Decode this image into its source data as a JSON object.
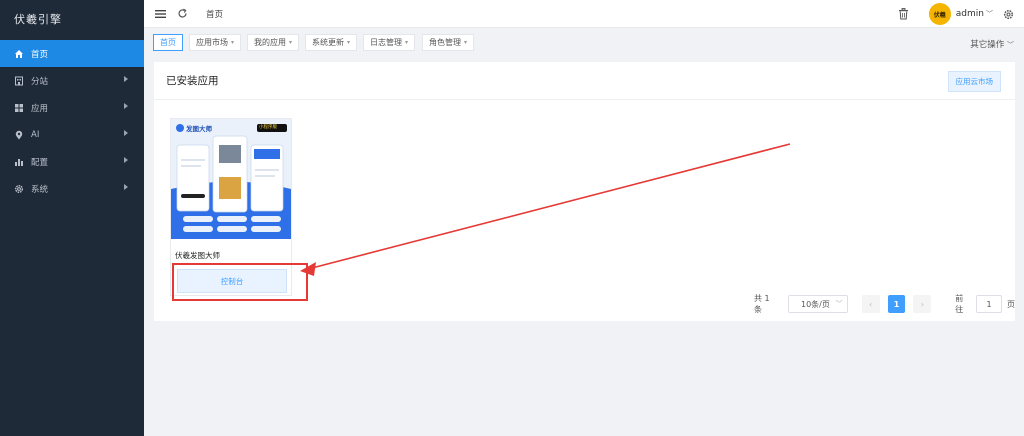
{
  "brand": "伏羲引擎",
  "sidebar": {
    "items": [
      {
        "label": "首页",
        "icon": "home-icon",
        "active": true
      },
      {
        "label": "分站",
        "icon": "building-icon"
      },
      {
        "label": "应用",
        "icon": "grid-icon"
      },
      {
        "label": "AI",
        "icon": "location-icon"
      },
      {
        "label": "配置",
        "icon": "bar-chart-icon"
      },
      {
        "label": "系统",
        "icon": "gear-icon"
      }
    ]
  },
  "topbar": {
    "breadcrumb": "首页",
    "username": "admin",
    "avatar_text": "伏羲"
  },
  "tabs": [
    {
      "label": "首页",
      "active": true
    },
    {
      "label": "应用市场"
    },
    {
      "label": "我的应用"
    },
    {
      "label": "系统更新"
    },
    {
      "label": "日志管理"
    },
    {
      "label": "角色管理"
    }
  ],
  "other_ops": "其它操作",
  "panel": {
    "title": "已安装应用",
    "market_button": "应用云市场"
  },
  "app": {
    "name": "伏羲发图大师",
    "console_button": "控制台",
    "thumb": {
      "title": "发图大师",
      "badge": "小程序版"
    }
  },
  "pagination": {
    "total": "共 1 条",
    "page_size": "10条/页",
    "current_page": "1",
    "goto_label": "前往",
    "goto_value": "1",
    "page_suffix": "页"
  },
  "colors": {
    "sidebar_bg": "#1f2a38",
    "accent": "#409eff",
    "active_nav": "#1e88e5",
    "annotation_red": "#e53935"
  }
}
